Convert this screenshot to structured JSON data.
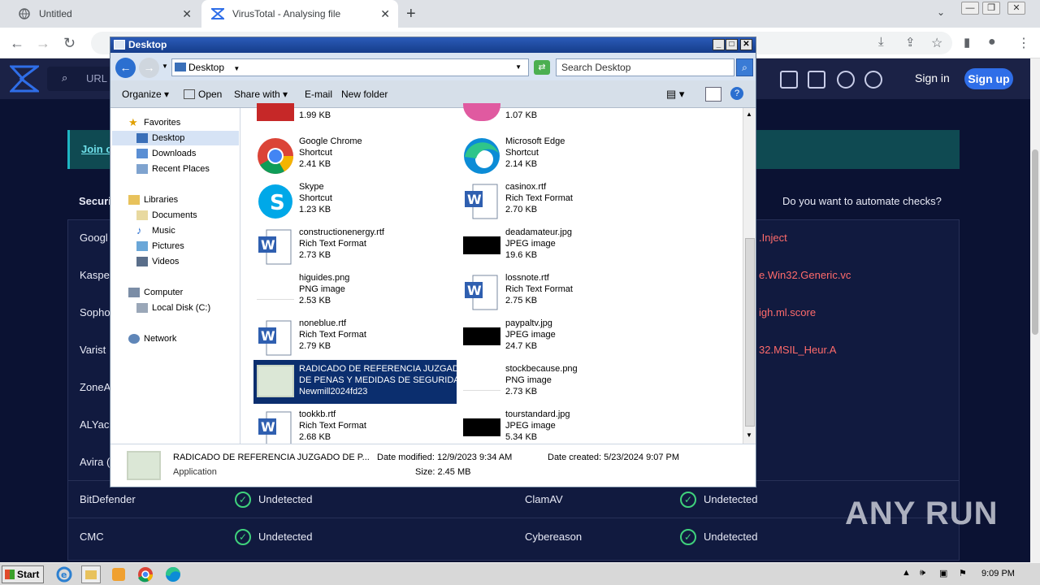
{
  "browser": {
    "tabs": [
      {
        "title": "Untitled"
      },
      {
        "title": "VirusTotal - Analysing file"
      }
    ],
    "url_placeholder": "URL"
  },
  "vt": {
    "signin": "Sign in",
    "signup": "Sign up",
    "join_text": "Join o",
    "section_left": "Securi",
    "section_right": "Do you want to automate checks?",
    "rows": [
      {
        "left": "Googl",
        "right": ".Inject"
      },
      {
        "left": "Kaspe",
        "right": "e.Win32.Generic.vc"
      },
      {
        "left": "Sopho",
        "right": "igh.ml.score"
      },
      {
        "left": "Varist",
        "right": "32.MSIL_Heur.A"
      },
      {
        "left": "ZoneA",
        "right": ""
      },
      {
        "left": "ALYac",
        "right": ""
      },
      {
        "left": "Avira (",
        "right": ""
      },
      {
        "left": "BitDefender",
        "status": "Undetected",
        "right_engine": "ClamAV",
        "right_status": "Undetected"
      },
      {
        "left": "CMC",
        "status": "Undetected",
        "right_engine": "Cybereason",
        "right_status": "Undetected"
      }
    ]
  },
  "explorer": {
    "title": "Desktop",
    "address": "Desktop",
    "search_placeholder": "Search Desktop",
    "toolbar": {
      "organize": "Organize",
      "open": "Open",
      "share": "Share with",
      "email": "E-mail",
      "new_folder": "New folder"
    },
    "nav": {
      "favorites": "Favorites",
      "desktop": "Desktop",
      "downloads": "Downloads",
      "recent": "Recent Places",
      "libraries": "Libraries",
      "documents": "Documents",
      "music": "Music",
      "pictures": "Pictures",
      "videos": "Videos",
      "computer": "Computer",
      "local_disk": "Local Disk (C:)",
      "network": "Network"
    },
    "files": [
      {
        "name": "",
        "type": "",
        "size": "1.99 KB"
      },
      {
        "name": "",
        "type": "",
        "size": "1.07 KB"
      },
      {
        "name": "Google Chrome",
        "type": "Shortcut",
        "size": "2.41 KB"
      },
      {
        "name": "Microsoft Edge",
        "type": "Shortcut",
        "size": "2.14 KB"
      },
      {
        "name": "Skype",
        "type": "Shortcut",
        "size": "1.23 KB"
      },
      {
        "name": "casinox.rtf",
        "type": "Rich Text Format",
        "size": "2.70 KB"
      },
      {
        "name": "constructionenergy.rtf",
        "type": "Rich Text Format",
        "size": "2.73 KB"
      },
      {
        "name": "deadamateur.jpg",
        "type": "JPEG image",
        "size": "19.6 KB"
      },
      {
        "name": "higuides.png",
        "type": "PNG image",
        "size": "2.53 KB"
      },
      {
        "name": "lossnote.rtf",
        "type": "Rich Text Format",
        "size": "2.75 KB"
      },
      {
        "name": "noneblue.rtf",
        "type": "Rich Text Format",
        "size": "2.79 KB"
      },
      {
        "name": "paypaltv.jpg",
        "type": "JPEG image",
        "size": "24.7 KB"
      },
      {
        "name": "RADICADO DE REFERENCIA JUZGADO",
        "type": "DE PENAS Y MEDIDAS DE SEGURIDA...",
        "size": "Newmill2024fd23"
      },
      {
        "name": "stockbecause.png",
        "type": "PNG image",
        "size": "2.73 KB"
      },
      {
        "name": "tookkb.rtf",
        "type": "Rich Text Format",
        "size": "2.68 KB"
      },
      {
        "name": "tourstandard.jpg",
        "type": "JPEG image",
        "size": "5.34 KB"
      }
    ],
    "status": {
      "name": "RADICADO DE REFERENCIA JUZGADO DE P...",
      "kind": "Application",
      "modified": "Date modified: 12/9/2023 9:34 AM",
      "created": "Date created: 5/23/2024 9:07 PM",
      "size": "Size: 2.45 MB"
    }
  },
  "taskbar": {
    "start": "Start",
    "clock": "9:09 PM"
  },
  "watermark": "ANY RUN"
}
